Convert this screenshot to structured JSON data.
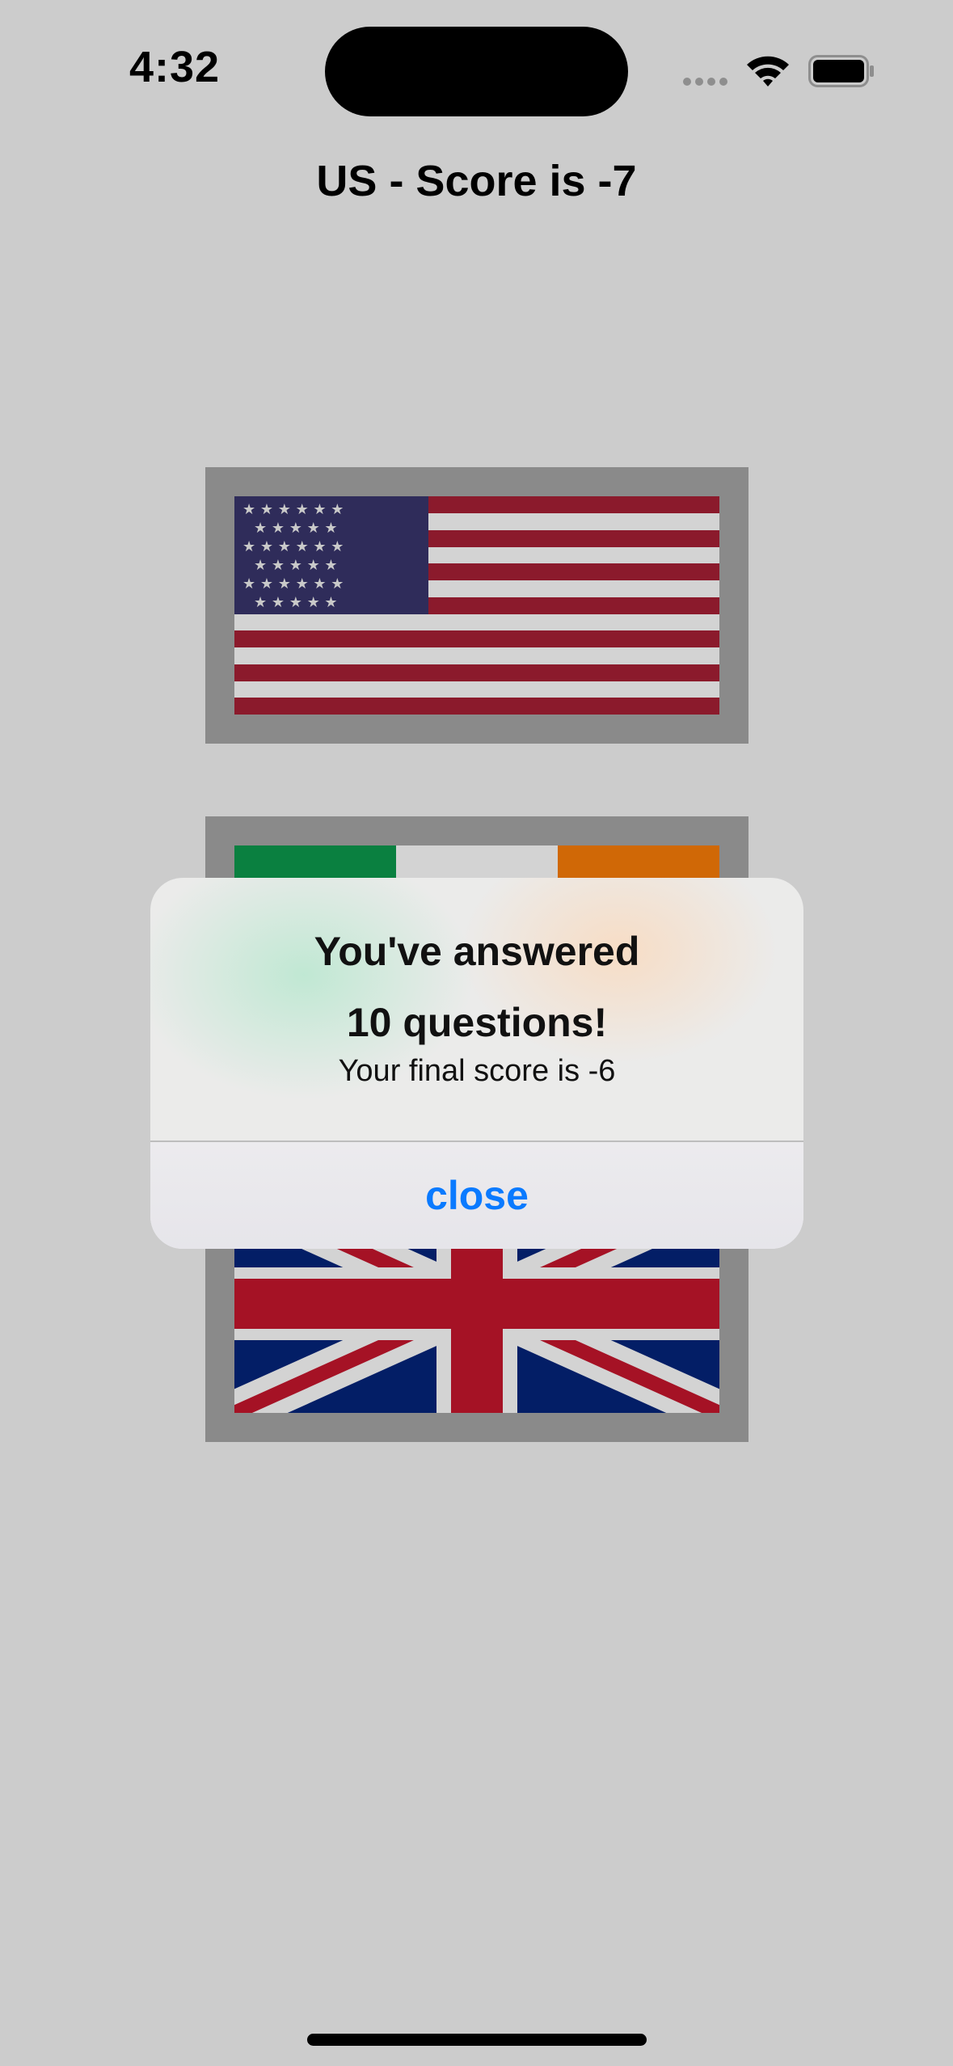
{
  "status_bar": {
    "time": "4:32",
    "icons": [
      "cellular-signal-icon",
      "wifi-icon",
      "battery-icon"
    ]
  },
  "nav": {
    "title": "US - Score is -7"
  },
  "flags": [
    {
      "name": "United States flag"
    },
    {
      "name": "Ireland flag"
    },
    {
      "name": "United Kingdom flag"
    }
  ],
  "alert": {
    "title_line1": "You've answered",
    "title_line2": "10 questions!",
    "message": "Your final score is -6",
    "button_label": "close"
  },
  "colors": {
    "background": "#cccccc",
    "flag_frame": "#8a8a8a",
    "accent": "#0a7aff"
  }
}
